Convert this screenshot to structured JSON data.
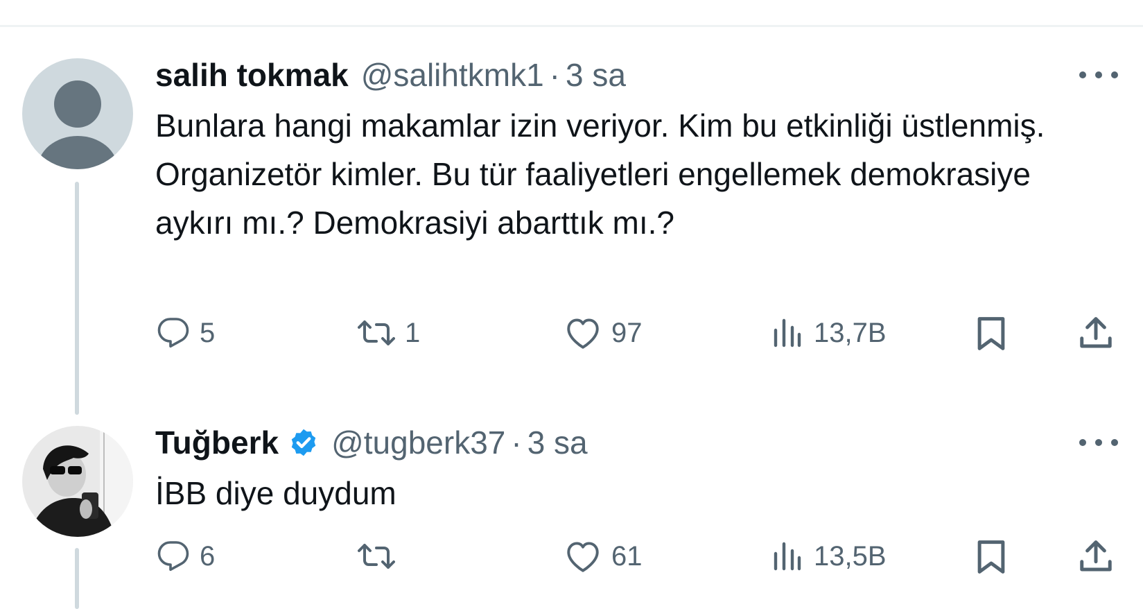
{
  "tweets": [
    {
      "display_name": "salih tokmak",
      "handle": "@salihtkmk1",
      "separator": "·",
      "time": "3 sa",
      "verified": false,
      "text": "Bunlara hangi makamlar izin veriyor. Kim bu etkinliği üstlenmiş. Organizetör kimler. Bu tür faaliyetleri engellemek demokrasiye aykırı mı.? Demokrasiyi abarttık mı.?",
      "replies": "5",
      "retweets": "1",
      "likes": "97",
      "views": "13,7B",
      "avatar": "default-person-avatar"
    },
    {
      "display_name": "Tuğberk",
      "handle": "@tugberk37",
      "separator": "·",
      "time": "3 sa",
      "verified": true,
      "text": "İBB diye duydum",
      "replies": "6",
      "retweets": "",
      "likes": "61",
      "views": "13,5B",
      "avatar": "photo-avatar"
    }
  ],
  "icons": {
    "reply": "reply-icon",
    "retweet": "retweet-icon",
    "like": "like-icon",
    "views": "views-icon",
    "bookmark": "bookmark-icon",
    "share": "share-icon",
    "more": "more-icon",
    "verified": "verified-badge-icon"
  },
  "colors": {
    "text": "#0f1419",
    "secondary": "#536471",
    "verified": "#1d9bf0",
    "thread_line": "#cfd9de",
    "background": "#ffffff"
  }
}
